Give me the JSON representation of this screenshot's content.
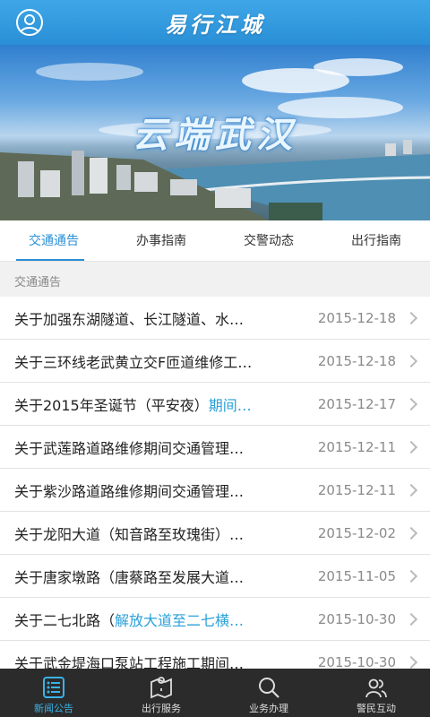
{
  "header": {
    "logo": "易行江城",
    "avatar_icon": "user-icon"
  },
  "banner": {
    "title": "云端武汉"
  },
  "tabs": [
    {
      "label": "交通通告",
      "active": true
    },
    {
      "label": "办事指南",
      "active": false
    },
    {
      "label": "交警动态",
      "active": false
    },
    {
      "label": "出行指南",
      "active": false
    }
  ],
  "section": {
    "label": "交通通告"
  },
  "notices": [
    {
      "title": "关于加强东湖隧道、长江隧道、水…",
      "highlight": "",
      "date": "2015-12-18"
    },
    {
      "title": "关于三环线老武黄立交F匝道维修工…",
      "highlight": "",
      "date": "2015-12-18"
    },
    {
      "title": "关于2015年圣诞节（平安夜）",
      "highlight": "期间…",
      "date": "2015-12-17"
    },
    {
      "title": "关于武莲路道路维修期间交通管理…",
      "highlight": "",
      "date": "2015-12-11"
    },
    {
      "title": "关于紫沙路道路维修期间交通管理…",
      "highlight": "",
      "date": "2015-12-11"
    },
    {
      "title": "关于龙阳大道（知音路至玫瑰街）…",
      "highlight": "",
      "date": "2015-12-02"
    },
    {
      "title": "关于唐家墩路（唐蔡路至发展大道…",
      "highlight": "",
      "date": "2015-11-05"
    },
    {
      "title": "关于二七北路（",
      "highlight": "解放大道至二七横…",
      "date": "2015-10-30"
    },
    {
      "title": "关于武金堤海口泵站工程施工期间…",
      "highlight": "",
      "date": "2015-10-30"
    }
  ],
  "bottom_nav": [
    {
      "label": "新闻公告",
      "icon": "news-list-icon",
      "active": true
    },
    {
      "label": "出行服务",
      "icon": "map-icon",
      "active": false
    },
    {
      "label": "业务办理",
      "icon": "search-icon",
      "active": false
    },
    {
      "label": "警民互动",
      "icon": "users-icon",
      "active": false
    }
  ],
  "colors": {
    "accent": "#2a8fd6",
    "header": "#3fa7e8",
    "nav_bg": "#2b2b2b",
    "highlight": "#2aa0d8"
  }
}
